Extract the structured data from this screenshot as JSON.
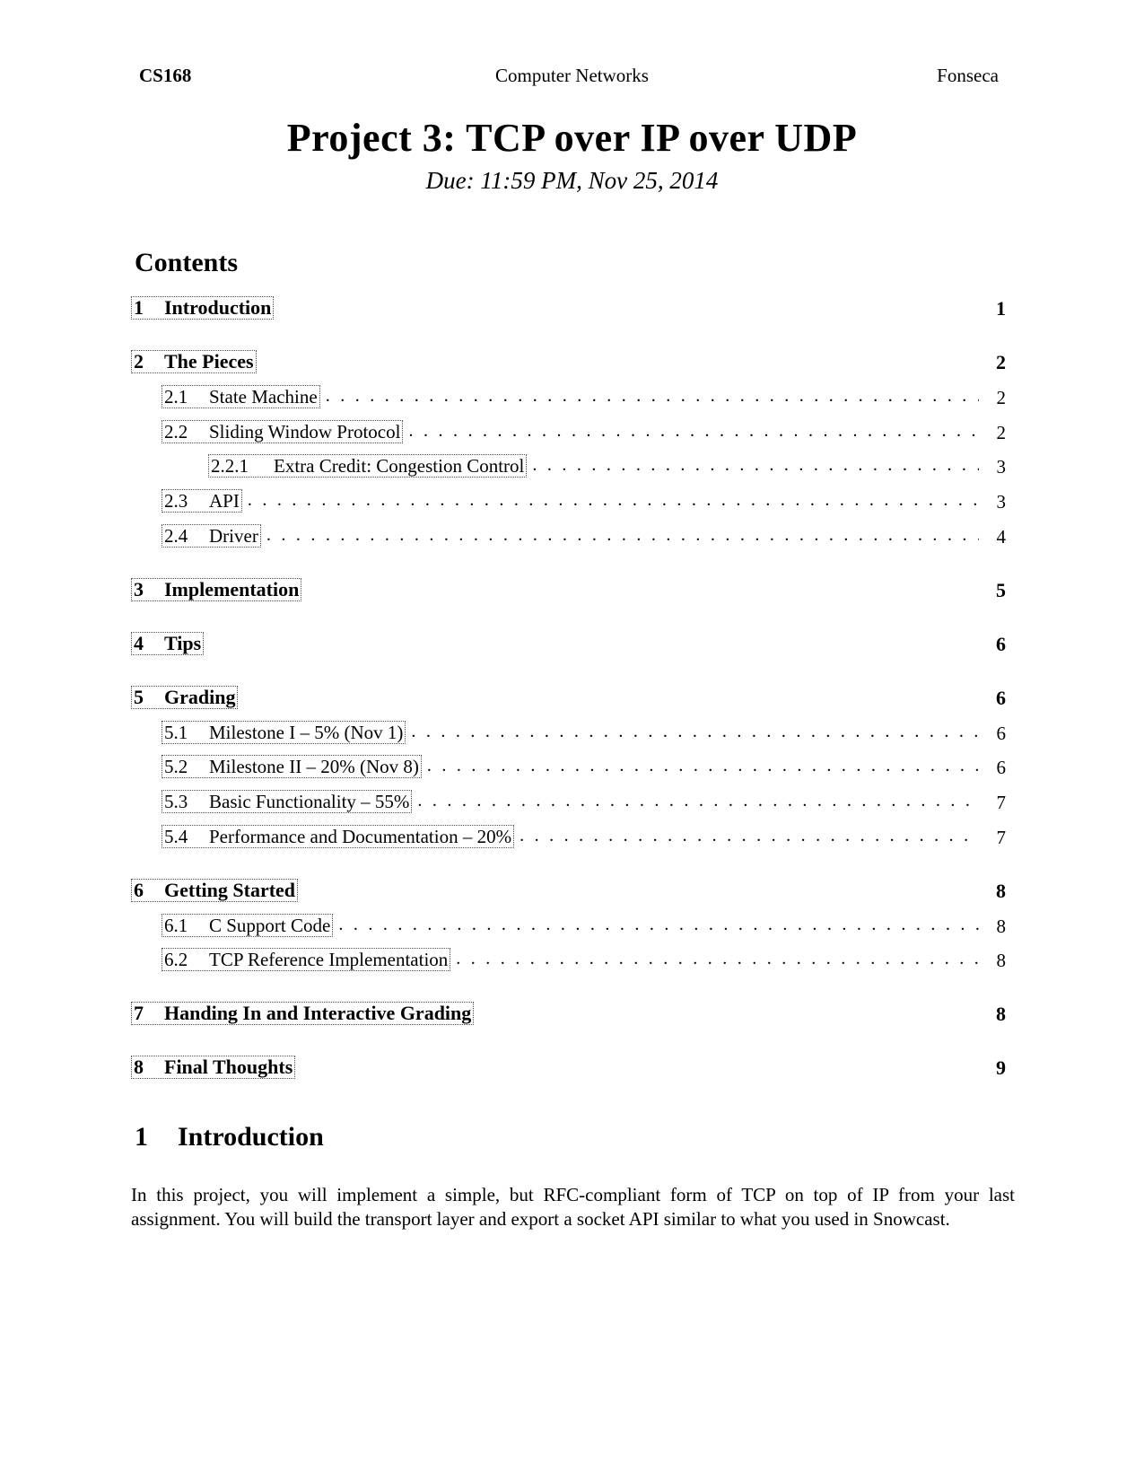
{
  "header": {
    "course": "CS168",
    "subject": "Computer Networks",
    "instructor": "Fonseca"
  },
  "title": "Project 3: TCP over IP over UDP",
  "due": "Due: 11:59 PM, Nov 25, 2014",
  "contents_heading": "Contents",
  "toc": [
    {
      "num": "1",
      "label": "Introduction",
      "page": "1",
      "level": 1
    },
    {
      "num": "2",
      "label": "The Pieces",
      "page": "2",
      "level": 1
    },
    {
      "num": "2.1",
      "label": "State Machine",
      "page": "2",
      "level": 2
    },
    {
      "num": "2.2",
      "label": "Sliding Window Protocol",
      "page": "2",
      "level": 2
    },
    {
      "num": "2.2.1",
      "label": "Extra Credit: Congestion Control",
      "page": "3",
      "level": 3
    },
    {
      "num": "2.3",
      "label": "API",
      "page": "3",
      "level": 2
    },
    {
      "num": "2.4",
      "label": "Driver",
      "page": "4",
      "level": 2
    },
    {
      "num": "3",
      "label": "Implementation",
      "page": "5",
      "level": 1
    },
    {
      "num": "4",
      "label": "Tips",
      "page": "6",
      "level": 1
    },
    {
      "num": "5",
      "label": "Grading",
      "page": "6",
      "level": 1
    },
    {
      "num": "5.1",
      "label": "Milestone I – 5% (Nov 1)",
      "page": "6",
      "level": 2
    },
    {
      "num": "5.2",
      "label": "Milestone II – 20% (Nov 8)",
      "page": "6",
      "level": 2
    },
    {
      "num": "5.3",
      "label": "Basic Functionality – 55%",
      "page": "7",
      "level": 2
    },
    {
      "num": "5.4",
      "label": "Performance and Documentation – 20%",
      "page": "7",
      "level": 2
    },
    {
      "num": "6",
      "label": "Getting Started",
      "page": "8",
      "level": 1
    },
    {
      "num": "6.1",
      "label": "C Support Code",
      "page": "8",
      "level": 2
    },
    {
      "num": "6.2",
      "label": "TCP Reference Implementation",
      "page": "8",
      "level": 2
    },
    {
      "num": "7",
      "label": "Handing In and Interactive Grading",
      "page": "8",
      "level": 1
    },
    {
      "num": "8",
      "label": "Final Thoughts",
      "page": "9",
      "level": 1
    }
  ],
  "section1": {
    "num": "1",
    "title": "Introduction",
    "paragraph": "In this project, you will implement a simple, but RFC-compliant form of TCP on top of IP from your last assignment. You will build the transport layer and export a socket API similar to what you used in Snowcast."
  }
}
